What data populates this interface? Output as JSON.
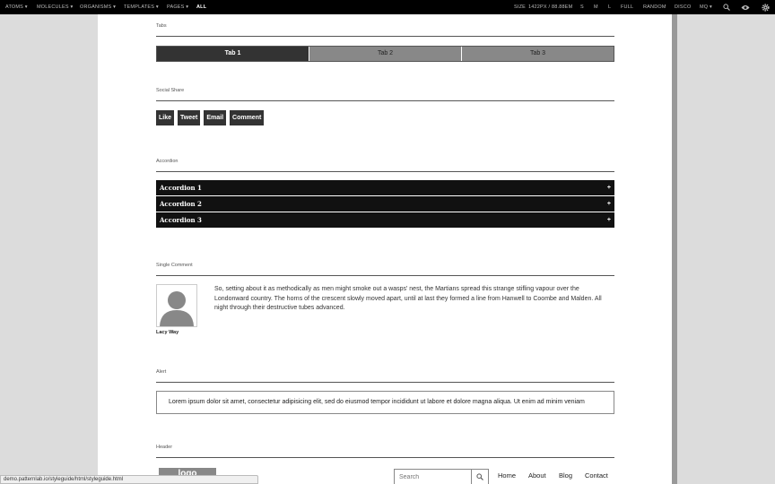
{
  "toolbar": {
    "menus": [
      "ATOMS ▾",
      "MOLECULES ▾",
      "ORGANISMS ▾",
      "TEMPLATES ▾",
      "PAGES ▾",
      "ALL"
    ],
    "size_label": "SIZE",
    "size_value": "1422PX / 88.88EM",
    "sizes": [
      "S",
      "M",
      "L",
      "FULL",
      "RANDOM",
      "DISCO",
      "MQ ▾"
    ],
    "icons": [
      "search-icon",
      "eye-icon",
      "gear-icon"
    ]
  },
  "tabs_section": {
    "label": "Tabs",
    "tabs": [
      "Tab 1",
      "Tab 2",
      "Tab 3"
    ]
  },
  "social_section": {
    "label": "Social Share",
    "buttons": [
      "Like",
      "Tweet",
      "Email",
      "Comment"
    ]
  },
  "accordion_section": {
    "label": "Accordion",
    "items": [
      "Accordion 1",
      "Accordion 2",
      "Accordion 3"
    ],
    "toggle": "+"
  },
  "comment_section": {
    "label": "Single Comment",
    "author": "Lacy Way",
    "text": "So, setting about it as methodically as men might smoke out a wasps' nest, the Martians spread this strange stifling vapour over the Londonward country. The horns of the crescent slowly moved apart, until at last they formed a line from Hanwell to Coombe and Malden. All night through their destructive tubes advanced."
  },
  "alert_section": {
    "label": "Alert",
    "text": "Lorem ipsum dolor sit amet, consectetur adipisicing elit, sed do eiusmod tempor incididunt ut labore et dolore magna aliqua. Ut enim ad minim veniam"
  },
  "header_section": {
    "label": "Header",
    "logo": "logo",
    "search_placeholder": "Search",
    "nav": [
      "Home",
      "About",
      "Blog",
      "Contact"
    ]
  },
  "status_url": "demo.patternlab.io/styleguide/html/styleguide.html",
  "colors": {
    "toolbar_bg": "#000000",
    "tab_active": "#333333",
    "accordion_bg": "#111111",
    "canvas_bg": "#dcdcdc"
  }
}
